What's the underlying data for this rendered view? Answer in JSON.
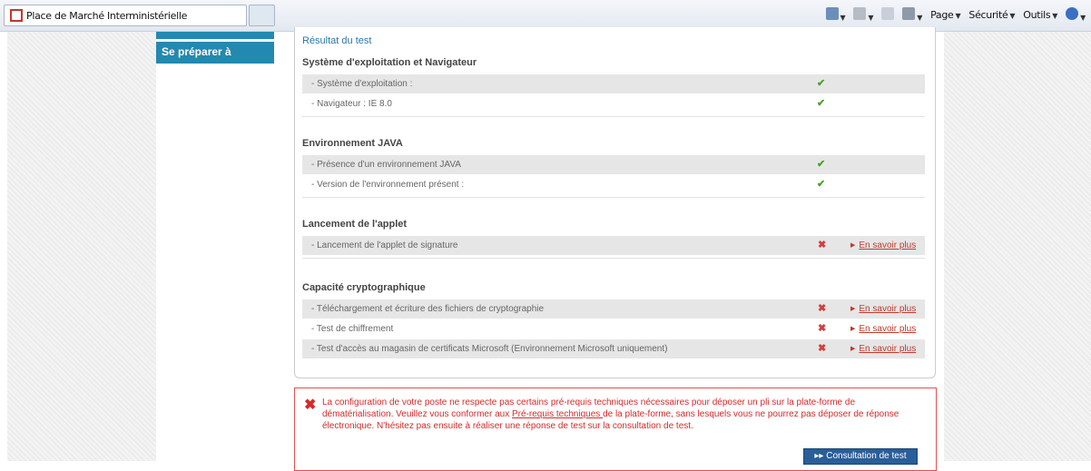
{
  "browser": {
    "tab_title": "Place de Marché Interministérielle",
    "toolbar": [
      "Page",
      "Sécurité",
      "Outils"
    ]
  },
  "nav": {
    "item_label": "Se préparer à répondre"
  },
  "results": {
    "title": "Résultat du test",
    "sections": [
      {
        "title": "Système d'exploitation et Navigateur",
        "rows": [
          {
            "label": "- Système d'exploitation :",
            "status": "ok"
          },
          {
            "label": "- Navigateur : IE 8.0",
            "status": "ok"
          }
        ]
      },
      {
        "title": "Environnement JAVA",
        "rows": [
          {
            "label": "- Présence d'un environnement JAVA",
            "status": "ok"
          },
          {
            "label": "- Version de l'environnement présent :",
            "status": "ok"
          }
        ]
      },
      {
        "title": "Lancement de l'applet",
        "rows": [
          {
            "label": "- Lancement de l'applet de signature",
            "status": "ko",
            "link": "En savoir plus"
          }
        ]
      },
      {
        "title": "Capacité cryptographique",
        "rows": [
          {
            "label": "- Téléchargement et écriture des fichiers de cryptographie",
            "status": "ko",
            "link": "En savoir plus"
          },
          {
            "label": "- Test de chiffrement",
            "status": "ko",
            "link": "En savoir plus"
          },
          {
            "label": "- Test d'accès au magasin de certificats Microsoft (Environnement Microsoft uniquement)",
            "status": "ko",
            "link": "En savoir plus"
          }
        ]
      }
    ],
    "ok_glyph": "✔",
    "ko_glyph": "✖"
  },
  "error": {
    "text_1": "La configuration de votre poste ne respecte pas certains pré-requis techniques nécessaires pour déposer un pli sur la plate-forme de dématérialisation. Veuillez vous conformer aux ",
    "link": "Pré-requis techniques ",
    "text_2": "de la plate-forme, sans lesquels vous ne pourrez pas déposer de réponse électronique. N'hésitez pas ensuite à réaliser une réponse de test sur la consultation de test.",
    "button": "Consultation de test"
  },
  "colors": {
    "accent": "#2389b0",
    "ok": "#4aa02c",
    "error": "#d63b3b"
  }
}
